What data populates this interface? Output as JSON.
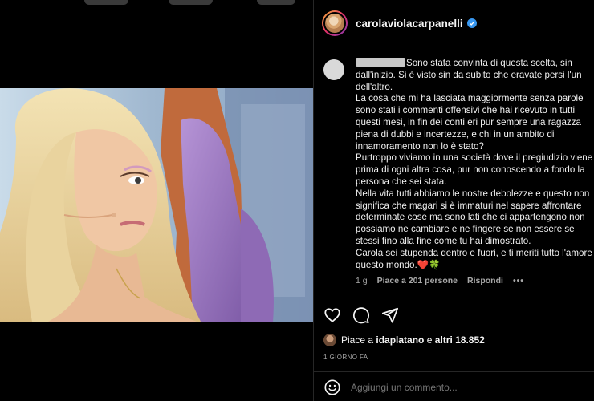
{
  "post": {
    "username": "carolaviolacarpanelli",
    "verified": true
  },
  "comment": {
    "text": "Sono stata convinta di questa scelta, sin dall'inizio. Si è visto sin da subito che eravate persi l'un dell'altro.\nLa cosa che mi ha lasciata maggiormente senza parole sono stati i commenti offensivi che hai ricevuto in tutti questi mesi, in fin dei conti eri pur sempre una ragazza piena di dubbi e incertezze, e chi in un ambito di innamoramento non lo è stato?\nPurtroppo viviamo in una società dove il pregiudizio viene prima di ogni altra cosa, pur non conoscendo a fondo la persona che sei stata.\nNella vita tutti abbiamo le nostre debolezze e questo non significa che magari si è immaturi nel sapere affrontare determinate cose ma sono lati che ci appartengono non possiamo ne cambiare e ne fingere se non essere se stessi fino alla fine come tu hai dimostrato.\nCarola sei stupenda dentro e fuori, e ti meriti tutto l'amore questo mondo.❤️🍀",
    "time": "1 g",
    "likes": "Piace a 201 persone",
    "reply": "Rispondi",
    "more": "•••"
  },
  "likes": {
    "prefix": "Piace a",
    "user": "idaplatano",
    "joiner": "e",
    "others": "altri 18.852"
  },
  "date_label": "1 GIORNO FA",
  "add_comment": {
    "placeholder": "Aggiungi un commento..."
  },
  "icons": {
    "like": "heart-icon",
    "comment": "comment-icon",
    "share": "share-icon",
    "emoji": "emoji-icon",
    "verified": "verified-badge-icon"
  },
  "colors": {
    "background": "#000000",
    "verified": "#3897f0",
    "meta": "#a8a8a8"
  }
}
